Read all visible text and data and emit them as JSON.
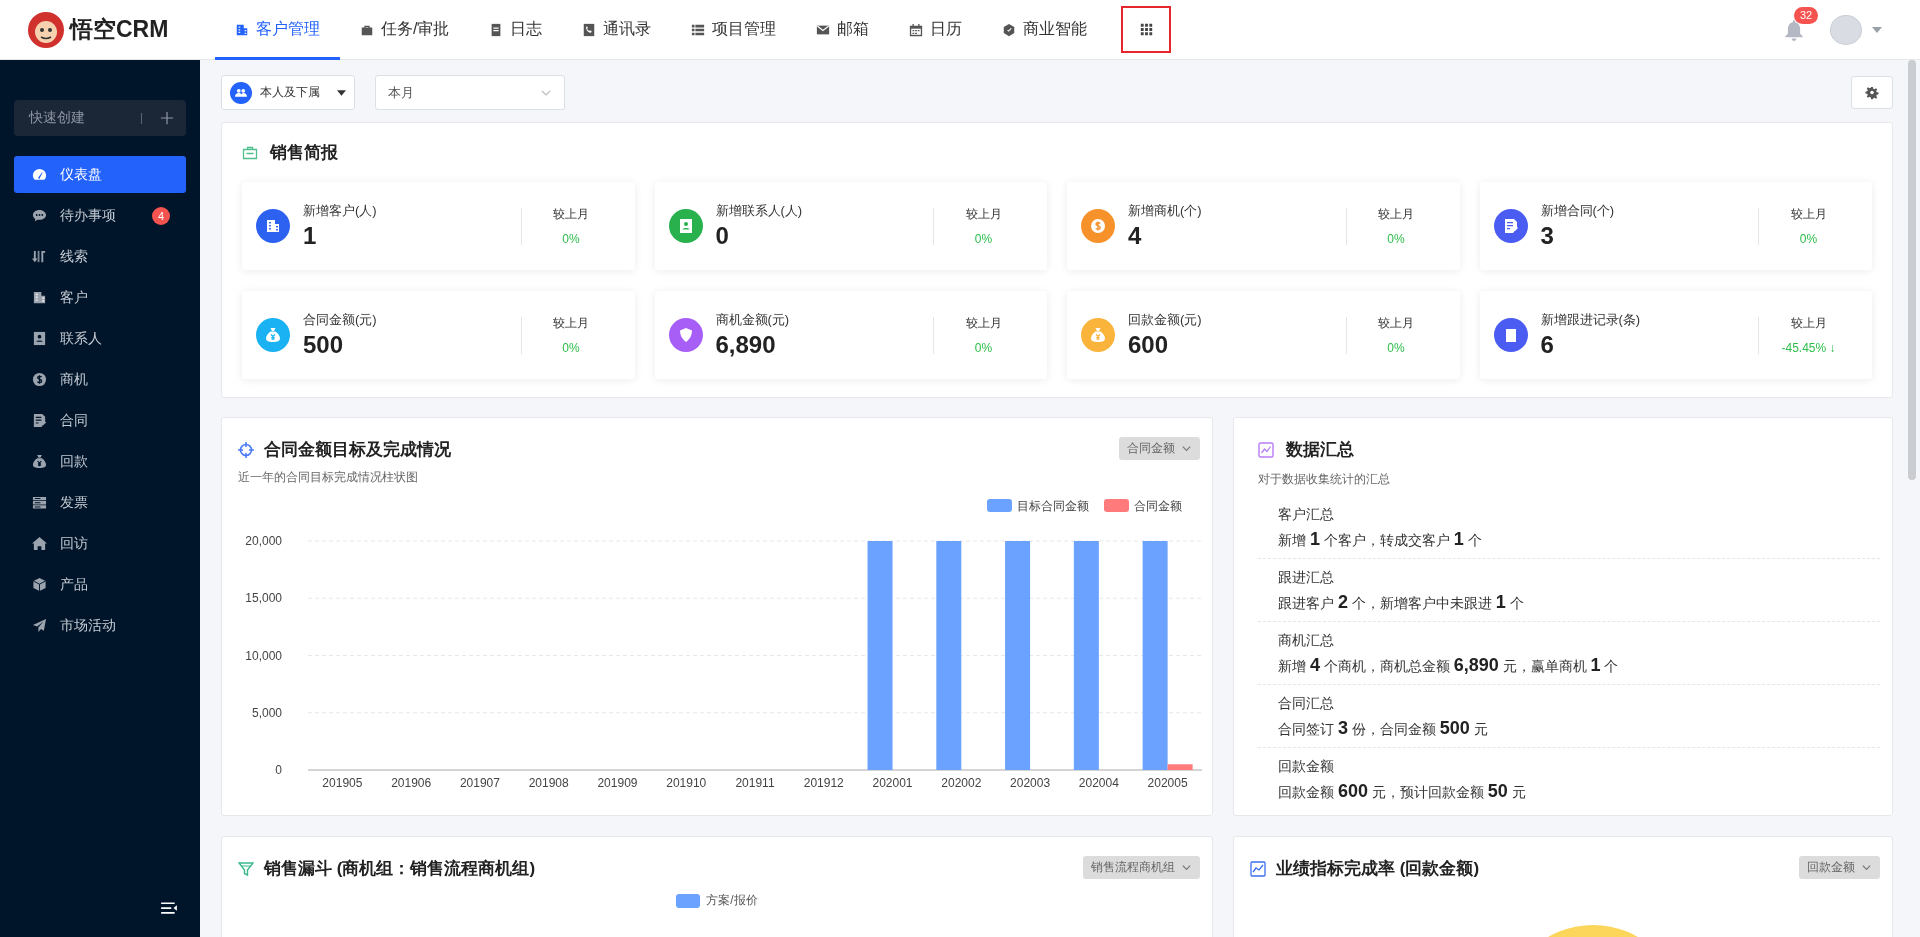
{
  "logo": {
    "text": "悟空CRM"
  },
  "nav": [
    {
      "label": "客户管理",
      "selected": true
    },
    {
      "label": "任务/审批",
      "selected": false
    },
    {
      "label": "日志",
      "selected": false
    },
    {
      "label": "通讯录",
      "selected": false
    },
    {
      "label": "项目管理",
      "selected": false
    },
    {
      "label": "邮箱",
      "selected": false
    },
    {
      "label": "日历",
      "selected": false
    },
    {
      "label": "商业智能",
      "selected": false
    }
  ],
  "apps_button": {
    "highlighted": true
  },
  "notifications": {
    "count": "32"
  },
  "sidebar": {
    "quick_create": "快速创建",
    "items": [
      {
        "label": "仪表盘",
        "selected": true
      },
      {
        "label": "待办事项",
        "selected": false,
        "badge": "4"
      },
      {
        "label": "线索",
        "selected": false
      },
      {
        "label": "客户",
        "selected": false
      },
      {
        "label": "联系人",
        "selected": false
      },
      {
        "label": "商机",
        "selected": false
      },
      {
        "label": "合同",
        "selected": false
      },
      {
        "label": "回款",
        "selected": false
      },
      {
        "label": "发票",
        "selected": false
      },
      {
        "label": "回访",
        "selected": false
      },
      {
        "label": "产品",
        "selected": false
      },
      {
        "label": "市场活动",
        "selected": false
      }
    ]
  },
  "filters": {
    "scope": "本人及下属",
    "period": "本月"
  },
  "sales_report": {
    "title": "销售简报",
    "cards": [
      {
        "label": "新增客户(人)",
        "value": "1",
        "compare_label": "较上月",
        "change": "0%",
        "color": "#2d62f0"
      },
      {
        "label": "新增联系人(人)",
        "value": "0",
        "compare_label": "较上月",
        "change": "0%",
        "color": "#28b14c"
      },
      {
        "label": "新增商机(个)",
        "value": "4",
        "compare_label": "较上月",
        "change": "0%",
        "color": "#f7922a"
      },
      {
        "label": "新增合同(个)",
        "value": "3",
        "compare_label": "较上月",
        "change": "0%",
        "color": "#4a5cf2"
      },
      {
        "label": "合同金额(元)",
        "value": "500",
        "compare_label": "较上月",
        "change": "0%",
        "color": "#1ab2f2"
      },
      {
        "label": "商机金额(元)",
        "value": "6,890",
        "compare_label": "较上月",
        "change": "0%",
        "color": "#a75ef6"
      },
      {
        "label": "回款金额(元)",
        "value": "600",
        "compare_label": "较上月",
        "change": "0%",
        "color": "#fbb43b"
      },
      {
        "label": "新增跟进记录(条)",
        "value": "6",
        "compare_label": "较上月",
        "change": "-45.45% ↓",
        "color": "#4a5cf2"
      }
    ]
  },
  "contract_chart": {
    "title": "合同金额目标及完成情况",
    "subtitle": "近一年的合同目标完成情况柱状图",
    "dropdown": "合同金额",
    "chart_data": {
      "type": "bar",
      "categories": [
        "201905",
        "201906",
        "201907",
        "201908",
        "201909",
        "201910",
        "201911",
        "201912",
        "202001",
        "202002",
        "202003",
        "202004",
        "202005"
      ],
      "series": [
        {
          "name": "目标合同金额",
          "color": "#6ba1ff",
          "values": [
            0,
            0,
            0,
            0,
            0,
            0,
            0,
            0,
            20000,
            20000,
            20000,
            20000,
            20000
          ]
        },
        {
          "name": "合同金额",
          "color": "#ff7a7a",
          "values": [
            0,
            0,
            0,
            0,
            0,
            0,
            0,
            0,
            0,
            0,
            0,
            0,
            500
          ]
        }
      ],
      "ylim": [
        0,
        20000
      ],
      "grid": true,
      "legend": true,
      "yticks": [
        {
          "value": 0,
          "label": "0"
        },
        {
          "value": 5000,
          "label": "5,000"
        },
        {
          "value": 10000,
          "label": "10,000"
        },
        {
          "value": 15000,
          "label": "15,000"
        },
        {
          "value": 20000,
          "label": "20,000"
        }
      ]
    }
  },
  "data_summary": {
    "title": "数据汇总",
    "subtitle": "对于数据收集统计的汇总",
    "items": [
      {
        "title": "客户汇总",
        "text": "新增 **1** 个客户，转成交客户 **1** 个"
      },
      {
        "title": "跟进汇总",
        "text": "跟进客户 **2** 个，新增客户中未跟进 **1** 个"
      },
      {
        "title": "商机汇总",
        "text": "新增 **4** 个商机，商机总金额 **6,890** 元，赢单商机 **1** 个"
      },
      {
        "title": "合同汇总",
        "text": "合同签订 **3** 份，合同金额 **500** 元"
      },
      {
        "title": "回款金额",
        "text": "回款金额 **600** 元，预计回款金额 **50** 元"
      }
    ]
  },
  "sales_funnel": {
    "title": "销售漏斗 (商机组：销售流程商机组)",
    "dropdown": "销售流程商机组",
    "legend": [
      "方案/报价"
    ]
  },
  "performance": {
    "title": "业绩指标完成率 (回款金额)",
    "dropdown": "回款金额"
  }
}
